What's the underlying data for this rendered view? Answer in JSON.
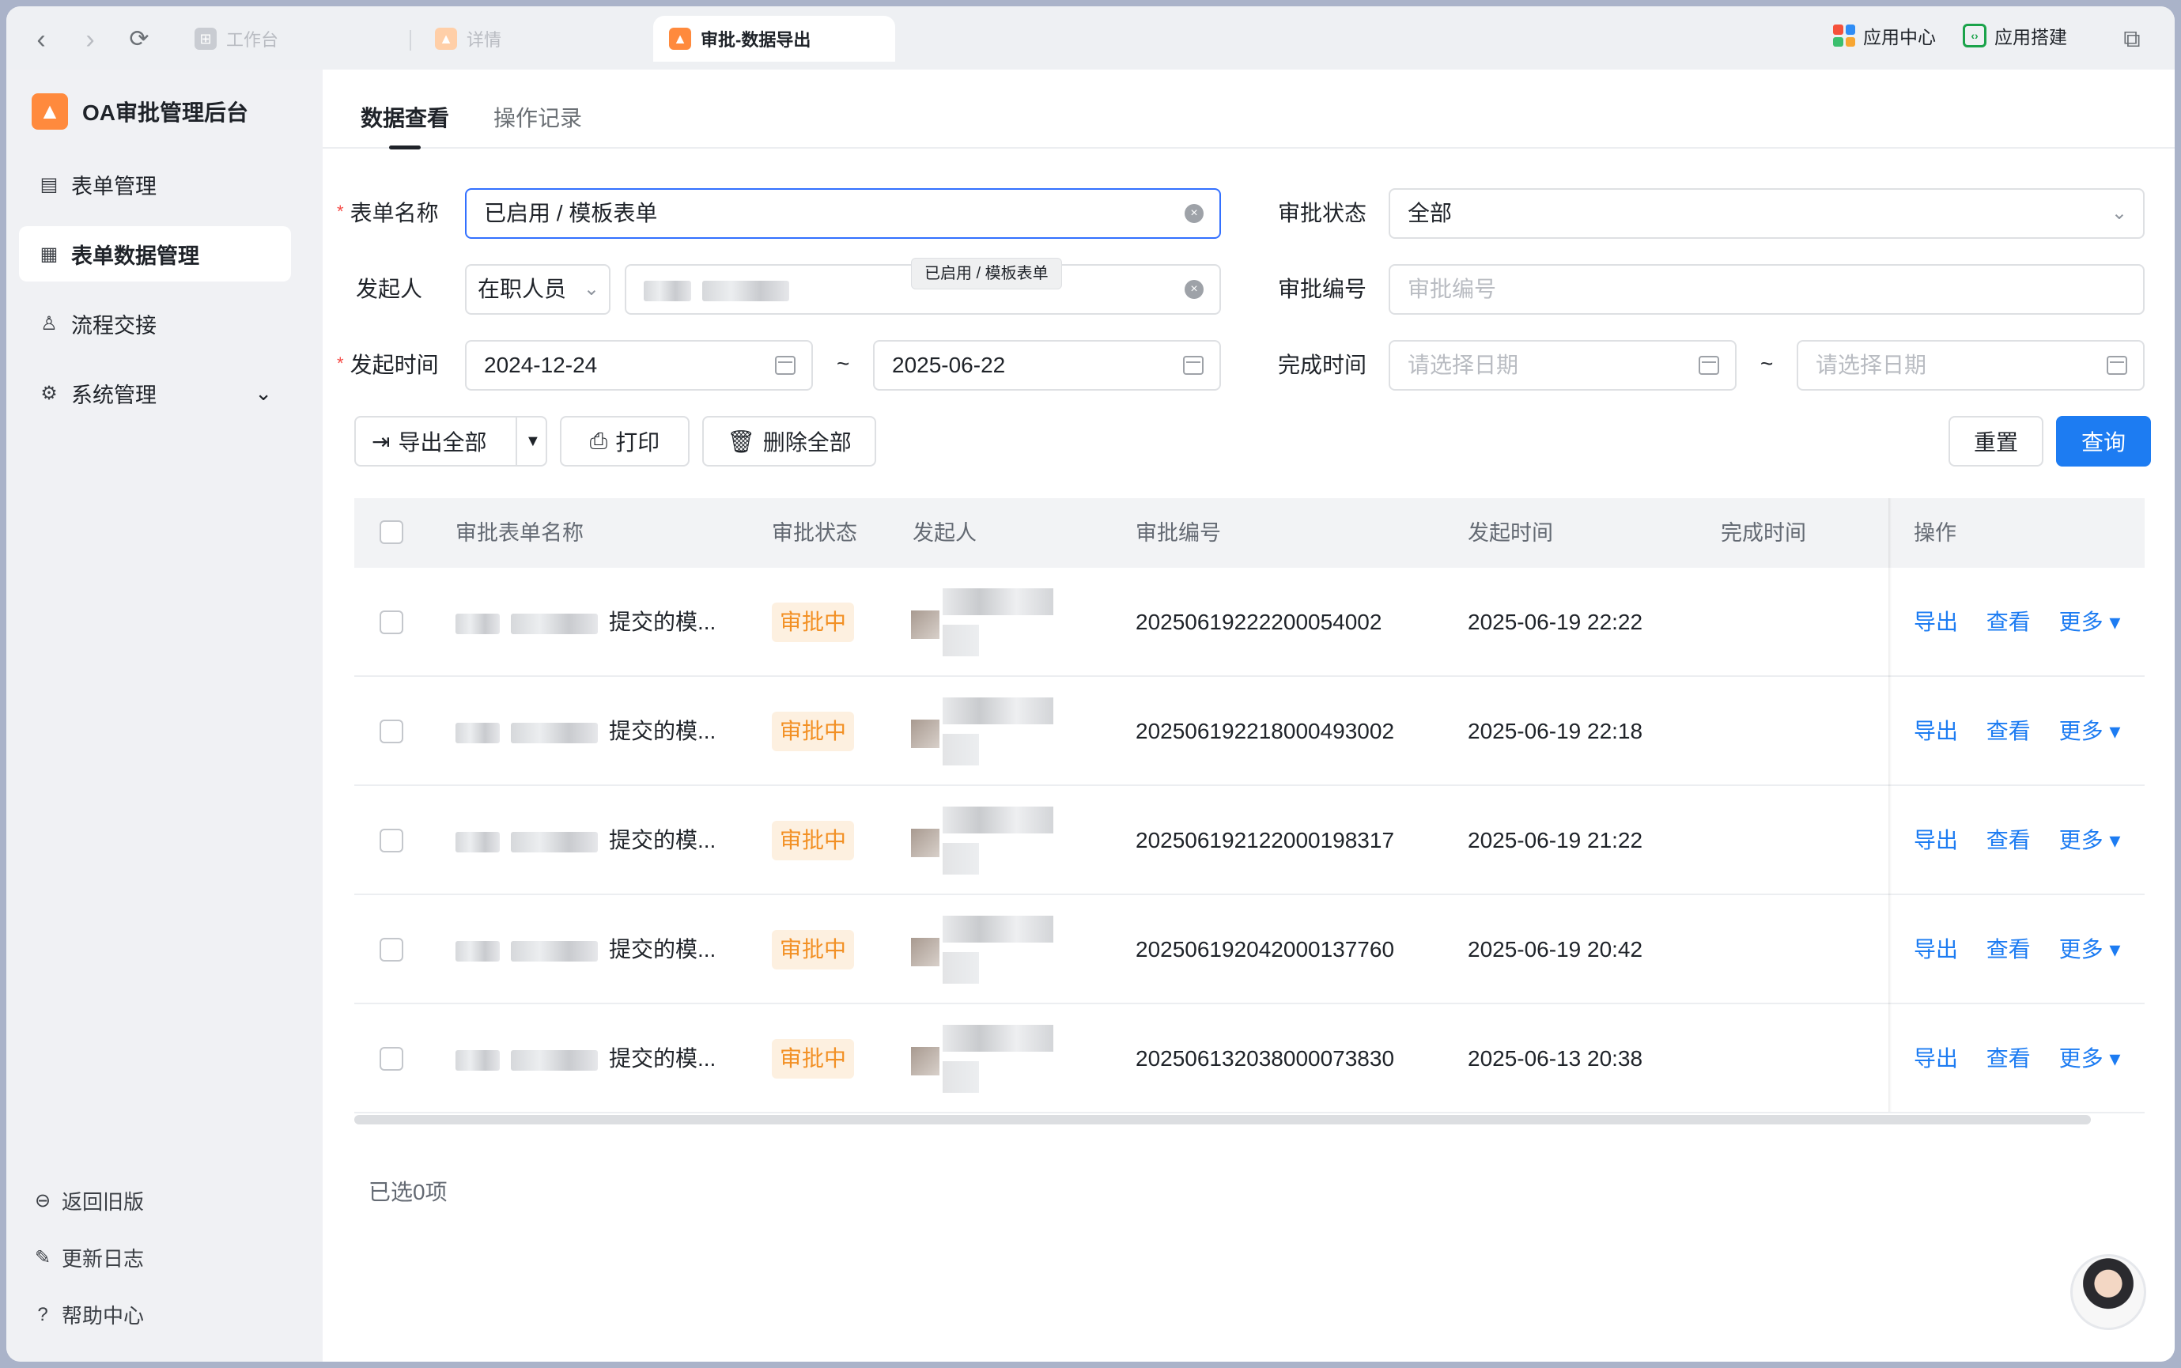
{
  "browser": {
    "tabs": [
      {
        "label": "工作台",
        "active": false
      },
      {
        "label": "详情",
        "active": false
      },
      {
        "label": "审批-数据导出",
        "active": true
      }
    ],
    "app_center": "应用中心",
    "app_build": "应用搭建"
  },
  "sidebar": {
    "brand": "OA审批管理后台",
    "items": [
      {
        "label": "表单管理",
        "icon": "form-icon"
      },
      {
        "label": "表单数据管理",
        "icon": "form-data-icon",
        "active": true
      },
      {
        "label": "流程交接",
        "icon": "user-handover-icon"
      },
      {
        "label": "系统管理",
        "icon": "gear-icon"
      }
    ],
    "bottom": [
      {
        "label": "返回旧版",
        "icon": "back-icon"
      },
      {
        "label": "更新日志",
        "icon": "edit-log-icon"
      },
      {
        "label": "帮助中心",
        "icon": "help-icon"
      }
    ]
  },
  "tabs": [
    "数据查看",
    "操作记录"
  ],
  "filters": {
    "form_name_label": "表单名称",
    "form_name_value": "已启用 / 模板表单",
    "tooltip": "已启用 / 模板表单",
    "status_label": "审批状态",
    "status_value": "全部",
    "initiator_label": "发起人",
    "initiator_type": "在职人员",
    "approval_no_label": "审批编号",
    "approval_no_placeholder": "审批编号",
    "start_time_label": "发起时间",
    "start_from": "2024-12-24",
    "start_to": "2025-06-22",
    "finish_time_label": "完成时间",
    "finish_from_placeholder": "请选择日期",
    "finish_to_placeholder": "请选择日期",
    "tilde": "~"
  },
  "actions": {
    "export_all": "导出全部",
    "print": "打印",
    "delete_all": "删除全部",
    "reset": "重置",
    "query": "查询"
  },
  "table": {
    "columns": [
      "审批表单名称",
      "审批状态",
      "发起人",
      "审批编号",
      "发起时间",
      "完成时间",
      "操作"
    ],
    "rows": [
      {
        "name_suffix": "提交的模...",
        "status": "审批中",
        "approval_no": "20250619222200054002",
        "start_time": "2025-06-19 22:22",
        "finish_time": ""
      },
      {
        "name_suffix": "提交的模...",
        "status": "审批中",
        "approval_no": "20250619221800049300 2",
        "start_time": "2025-06-19 22:18",
        "finish_time": ""
      },
      {
        "name_suffix": "提交的模...",
        "status": "审批中",
        "approval_no": "20250619212200019831 7",
        "start_time": "2025-06-19 21:22",
        "finish_time": ""
      },
      {
        "name_suffix": "提交的模...",
        "status": "审批中",
        "approval_no": "20250619204200013776 0",
        "start_time": "2025-06-19 20:42",
        "finish_time": ""
      },
      {
        "name_suffix": "提交的模...",
        "status": "审批中",
        "approval_no": "20250613203800007383 0",
        "start_time": "2025-06-13 20:38",
        "finish_time": ""
      }
    ],
    "row_actions": {
      "export": "导出",
      "view": "查看",
      "more": "更多 ▾"
    }
  },
  "footer": {
    "selected": "已选0项"
  }
}
